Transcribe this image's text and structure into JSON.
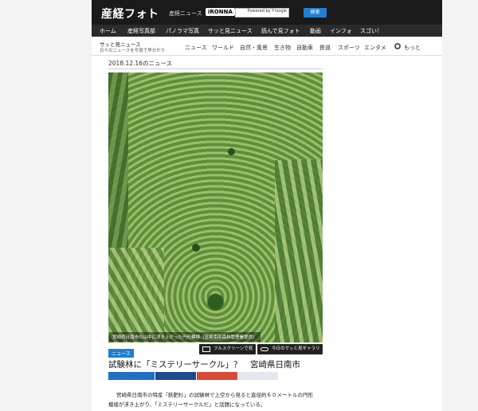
{
  "header": {
    "logo_text": "産経フォト",
    "links": [
      "産経ニュース",
      "iRONNA"
    ],
    "search_placeholder": "",
    "search_powered": "Powered by Y!oogle",
    "search_button": "検索"
  },
  "nav": {
    "items": [
      "ホーム",
      "産経写真部",
      "パノラマ写真",
      "サッと見ニュース",
      "読んで見フォト",
      "動画",
      "インフォ",
      "スゴい！"
    ]
  },
  "subnav": {
    "brand": "サッと見ニュース",
    "brand_sub": "日々のニュースを写真で早分かり",
    "categories": [
      "ニュース",
      "ワールド",
      "自然・風景",
      "生き物",
      "自動車",
      "鉄道",
      "スポーツ",
      "エンタメ"
    ],
    "more": "もっと"
  },
  "article": {
    "date": "2018.12.16のニュース",
    "photo_caption": "宮崎県日南市の山中に浮き上がった円形模様（宮崎南部森林管理署提供）",
    "fullscreen_button": "フルスクリーンで見る",
    "gallery_button": "今日のサッと見ギャラリー",
    "tag": "ニュース",
    "headline": "試験林に「ミステリーサークル」？　宮崎県日南市",
    "share_colors": [
      "#1f6fc5",
      "#1d4a8c",
      "#d94a36",
      "#e6e6e6"
    ],
    "body_line1": "宮崎県日南市の特産「飫肥杉」の試験林で上空から見ると直径約６０メートルの円形",
    "body_line2": "模様が浮き上がり、「ミステリーサークルだ」と話題になっている。"
  }
}
